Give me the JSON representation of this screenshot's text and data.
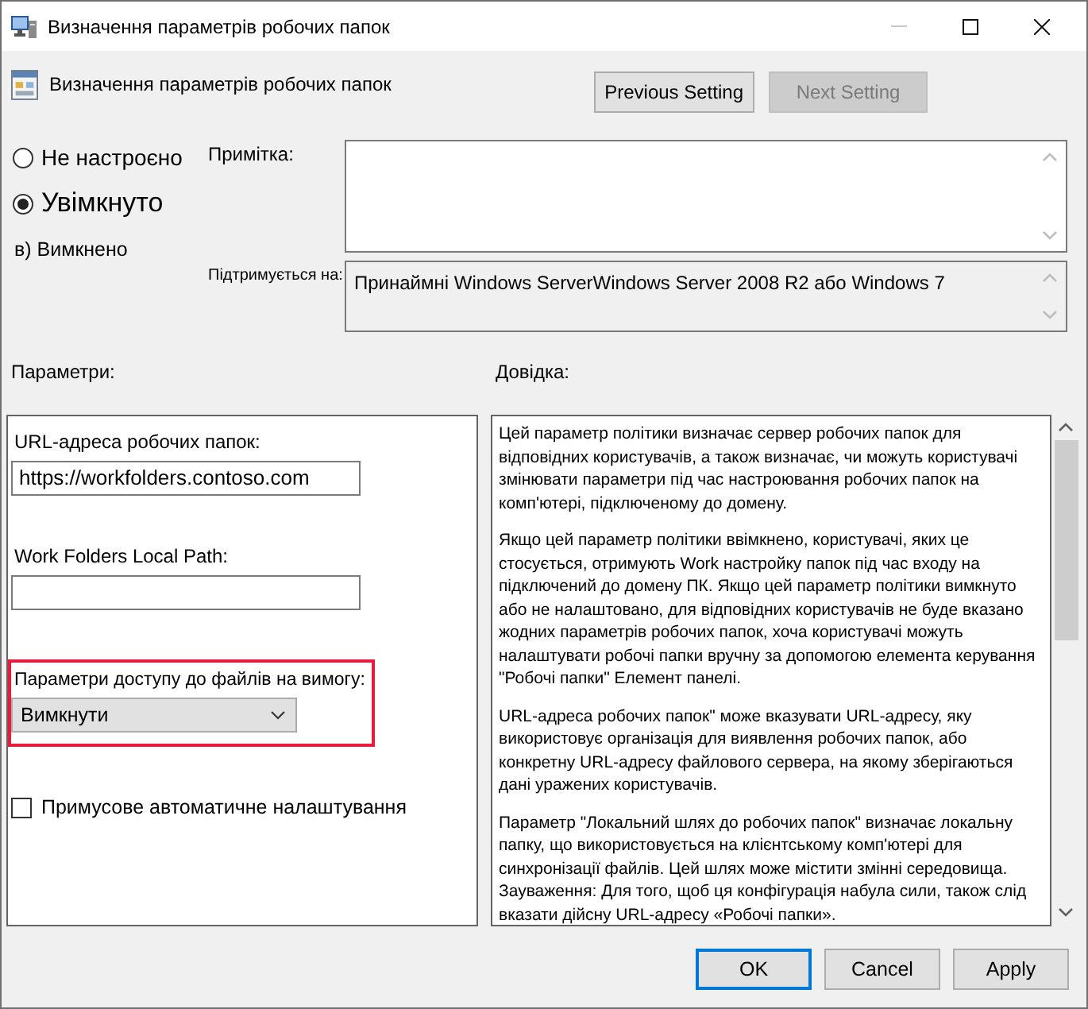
{
  "window": {
    "title": "Визначення параметрів робочих папок",
    "title_buttons": [
      {
        "kind": "minimize",
        "disabled": true
      },
      {
        "kind": "maximize",
        "disabled": false
      },
      {
        "kind": "close",
        "disabled": false
      }
    ]
  },
  "header": {
    "title": "Визначення параметрів робочих папок",
    "buttons": [
      {
        "label": "Previous Setting",
        "disabled": false
      },
      {
        "label": "Next Setting",
        "disabled": true
      }
    ]
  },
  "state_options": [
    {
      "kind": "radio",
      "label": "Не настроєно",
      "selected": false
    },
    {
      "kind": "radio",
      "label": "Увімкнуто",
      "selected": true
    },
    {
      "kind": "plain",
      "label": "в) Вимкнено",
      "selected": false
    }
  ],
  "comment": {
    "label": "Примітка:"
  },
  "supported_on": {
    "label": "Підтримується на:",
    "value": "Принаймні Windows ServerWindows Server 2008 R2 або Windows 7"
  },
  "options": {
    "heading": "Параметри:",
    "items": [
      {
        "kind": "text",
        "label": "URL-адреса робочих папок:",
        "value": "https://workfolders.contoso.com",
        "highlighted": false
      },
      {
        "kind": "text",
        "label": "Work Folders Local Path:",
        "highlighted": false
      },
      {
        "kind": "dropdown",
        "label": "Параметри доступу до файлів на вимогу:",
        "value": "Вимкнути",
        "highlighted": true
      },
      {
        "kind": "checkbox",
        "label": "Примусове автоматичне налаштування",
        "checked": false,
        "highlighted": false
      }
    ]
  },
  "help": {
    "heading": "Довідка:",
    "paragraphs": [
      "Цей параметр політики визначає сервер робочих папок для відповідних користувачів, а також визначає, чи можуть користувачі змінювати параметри під час настроювання робочих папок на комп'ютері, підключеному до домену.",
      "Якщо цей параметр політики ввімкнено, користувачі, яких це стосується, отримують Work настройку папок під час входу на підключений до домену ПК. Якщо цей параметр політики вимкнуто або не налаштовано, для відповідних користувачів не буде вказано жодних параметрів робочих папок, хоча користувачі можуть налаштувати робочі папки вручну за допомогою елемента керування \"Робочі папки\" Елемент панелі.",
      "URL-адреса робочих папок\" може вказувати URL-адресу, яку використовує організація для виявлення робочих папок, або конкретну URL-адресу файлового сервера, на якому зберігаються дані уражених користувачів.",
      "Параметр \"Локальний шлях до робочих папок\" визначає локальну папку, що використовується на клієнтському комп'ютері для синхронізації файлів. Цей шлях може містити змінні середовища. Зауваження: Для того, щоб ця конфігурація набула сили, також слід вказати дійсну URL-адресу «Робочі папки»."
    ]
  },
  "footer_buttons": [
    {
      "label": "OK",
      "focused": true
    },
    {
      "label": "Cancel",
      "focused": false
    },
    {
      "label": "Apply",
      "focused": false
    }
  ]
}
